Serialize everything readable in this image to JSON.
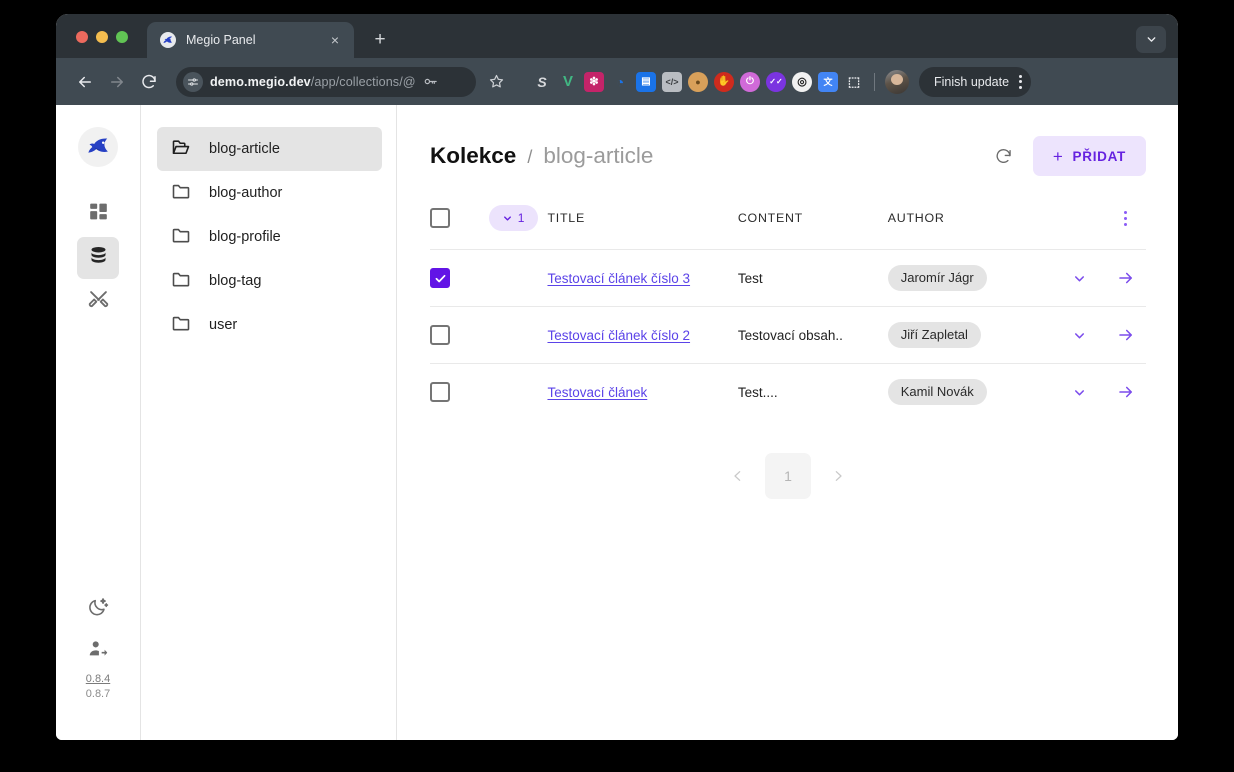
{
  "browser": {
    "tab": {
      "title": "Megio Panel",
      "favicon": "megio-shark-icon",
      "close": "×"
    },
    "new_tab": "+",
    "tabstrip_expand_icon": "chevron-down-icon",
    "toolbar": {
      "back_icon": "←",
      "forward_icon": "→",
      "reload_icon": "reload-icon",
      "site_info_icon": "tune-icon",
      "url_bold": "demo.megio.dev",
      "url_rest": "/app/collections/@",
      "key_icon": "key-icon",
      "star_icon": "star-icon",
      "profile_icon": "avatar",
      "finish_update_label": "Finish update",
      "menu_icon": "kebab-menu-icon"
    },
    "extensions": [
      {
        "name": "stylus-extension",
        "glyph": "S",
        "bg": "transparent",
        "color": "#d7d9dc"
      },
      {
        "name": "vue-devtools-extension",
        "glyph": "V",
        "bg": "transparent",
        "color": "#41b883"
      },
      {
        "name": "wappalyzer-extension",
        "glyph": "✿",
        "bg": "#c42469",
        "color": "#ffffff"
      },
      {
        "name": "tag-assistant-extension",
        "glyph": "◔",
        "bg": "transparent",
        "color": "#1a73e8"
      },
      {
        "name": "json-viewer-extension",
        "glyph": "▤",
        "bg": "#1a73e8",
        "color": "#ffffff"
      },
      {
        "name": "code-extension",
        "glyph": "</>",
        "bg": "#b9bdc2",
        "color": "#3c4043"
      },
      {
        "name": "cookie-editor-extension",
        "glyph": "●",
        "bg": "#d8a05a",
        "color": "#6b4a1d"
      },
      {
        "name": "ublock-origin-extension",
        "glyph": "✋",
        "bg": "#cf2b1d",
        "color": "#ffffff"
      },
      {
        "name": "power-extension",
        "glyph": "⏻",
        "bg": "#d06ad8",
        "color": "#ffffff"
      },
      {
        "name": "checkmarks-extension",
        "glyph": "✓✓",
        "bg": "#7b34e0",
        "color": "#ffffff"
      },
      {
        "name": "colorpick-extension",
        "glyph": "◎",
        "bg": "#f4f4f4",
        "color": "#222222"
      },
      {
        "name": "google-translate-extension",
        "glyph": "文",
        "bg": "#4285f4",
        "color": "#ffffff"
      },
      {
        "name": "extensions-puzzle-icon",
        "glyph": "⬚",
        "bg": "transparent",
        "color": "#e8eaed"
      }
    ]
  },
  "app": {
    "logo": "megio-shark-logo",
    "rail": [
      {
        "name": "dashboard",
        "icon": "grid-icon",
        "active": false
      },
      {
        "name": "collections",
        "icon": "database-icon",
        "active": true
      },
      {
        "name": "tools",
        "icon": "tools-icon",
        "active": false
      }
    ],
    "rail_bottom": [
      {
        "name": "dark-mode",
        "icon": "moon-icon"
      },
      {
        "name": "add-user",
        "icon": "person-add-icon"
      }
    ],
    "version_current": "0.8.4",
    "version_latest": "0.8.7"
  },
  "collections": {
    "items": [
      {
        "label": "blog-article",
        "icon": "folder-open-icon",
        "active": true
      },
      {
        "label": "blog-author",
        "icon": "folder-icon",
        "active": false
      },
      {
        "label": "blog-profile",
        "icon": "folder-icon",
        "active": false
      },
      {
        "label": "blog-tag",
        "icon": "folder-icon",
        "active": false
      },
      {
        "label": "user",
        "icon": "folder-icon",
        "active": false
      }
    ]
  },
  "main": {
    "breadcrumb_root": "Kolekce",
    "breadcrumb_separator": "/",
    "breadcrumb_leaf": "blog-article",
    "refresh_icon": "refresh-icon",
    "add_button_label": "PŘIDAT",
    "add_button_icon": "+",
    "table": {
      "selected_count": "1",
      "select_all_checked": false,
      "columns": [
        "TITLE",
        "CONTENT",
        "AUTHOR"
      ],
      "row_menu_icon": "kebab-menu-icon",
      "rows": [
        {
          "checked": true,
          "title": "Testovací článek číslo 3",
          "content": "Test",
          "author": "Jaromír Jágr",
          "expand_icon": "chevron-down-icon",
          "open_icon": "arrow-right-icon"
        },
        {
          "checked": false,
          "title": "Testovací článek číslo 2",
          "content": "Testovací obsah..",
          "author": "Jiří Zapletal",
          "expand_icon": "chevron-down-icon",
          "open_icon": "arrow-right-icon"
        },
        {
          "checked": false,
          "title": "Testovací článek",
          "content": "Test....",
          "author": "Kamil Novák",
          "expand_icon": "chevron-down-icon",
          "open_icon": "arrow-right-icon"
        }
      ]
    },
    "pagination": {
      "prev_icon": "‹",
      "next_icon": "›",
      "pages": [
        "1"
      ],
      "current": "1"
    }
  },
  "colors": {
    "accent": "#6622e0",
    "accent_soft": "#ede4fd",
    "checkbox": "#6214e6",
    "link": "#5b43e8",
    "chrome_tabstrip": "#2c3237",
    "chrome_toolbar": "#404a52"
  }
}
